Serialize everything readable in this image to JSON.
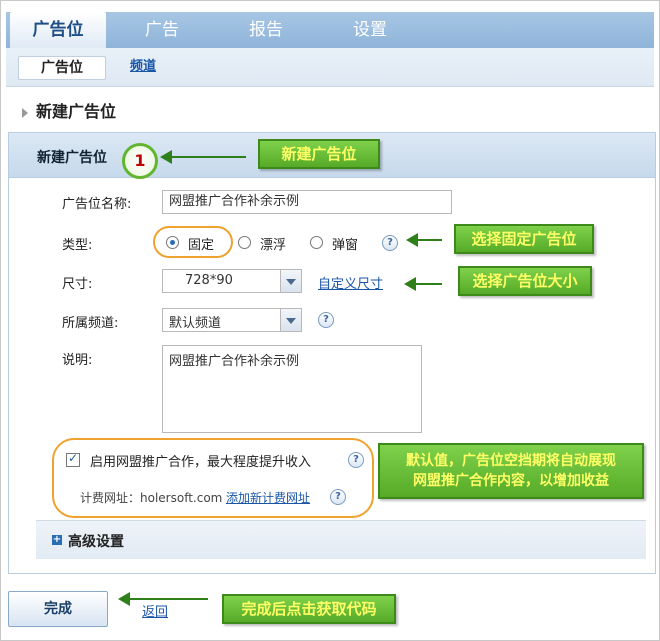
{
  "nav": {
    "tabs": [
      {
        "label": "广告位"
      },
      {
        "label": "广告"
      },
      {
        "label": "报告"
      },
      {
        "label": "设置"
      }
    ],
    "subtabs": [
      {
        "label": "广告位"
      },
      {
        "label": "频道"
      }
    ]
  },
  "page": {
    "title": "新建广告位"
  },
  "panel": {
    "title": "新建广告位",
    "step": "1"
  },
  "form": {
    "name": {
      "label": "广告位名称:",
      "value": "网盟推广合作补余示例"
    },
    "type": {
      "label": "类型:",
      "options": [
        "固定",
        "漂浮",
        "弹窗"
      ],
      "selected": "固定"
    },
    "size": {
      "label": "尺寸:",
      "value": "728*90",
      "custom_link": "自定义尺寸"
    },
    "channel": {
      "label": "所属频道:",
      "value": "默认频道"
    },
    "desc": {
      "label": "说明:",
      "value": "网盟推广合作补余示例"
    },
    "union": {
      "checkbox_label": "启用网盟推广合作，最大程度提升收入",
      "checked": true,
      "billing_label": "计费网址：holersoft.com",
      "add_link": "添加新计费网址"
    },
    "advanced": "高级设置",
    "help_glyph": "?"
  },
  "footer": {
    "finish": "完成",
    "back": "返回"
  },
  "callouts": {
    "new_slot": "新建广告位",
    "choose_fixed": "选择固定广告位",
    "choose_size": "选择广告位大小",
    "default_line1": "默认值，广告位空挡期将自动展现",
    "default_line2": "网盟推广合作内容，以增加收益",
    "finish_hint": "完成后点击获取代码"
  },
  "colors": {
    "accent_green": "#56aa27",
    "callout_text": "#ffff66",
    "highlight": "#f0a22e",
    "link": "#1a56a8"
  }
}
